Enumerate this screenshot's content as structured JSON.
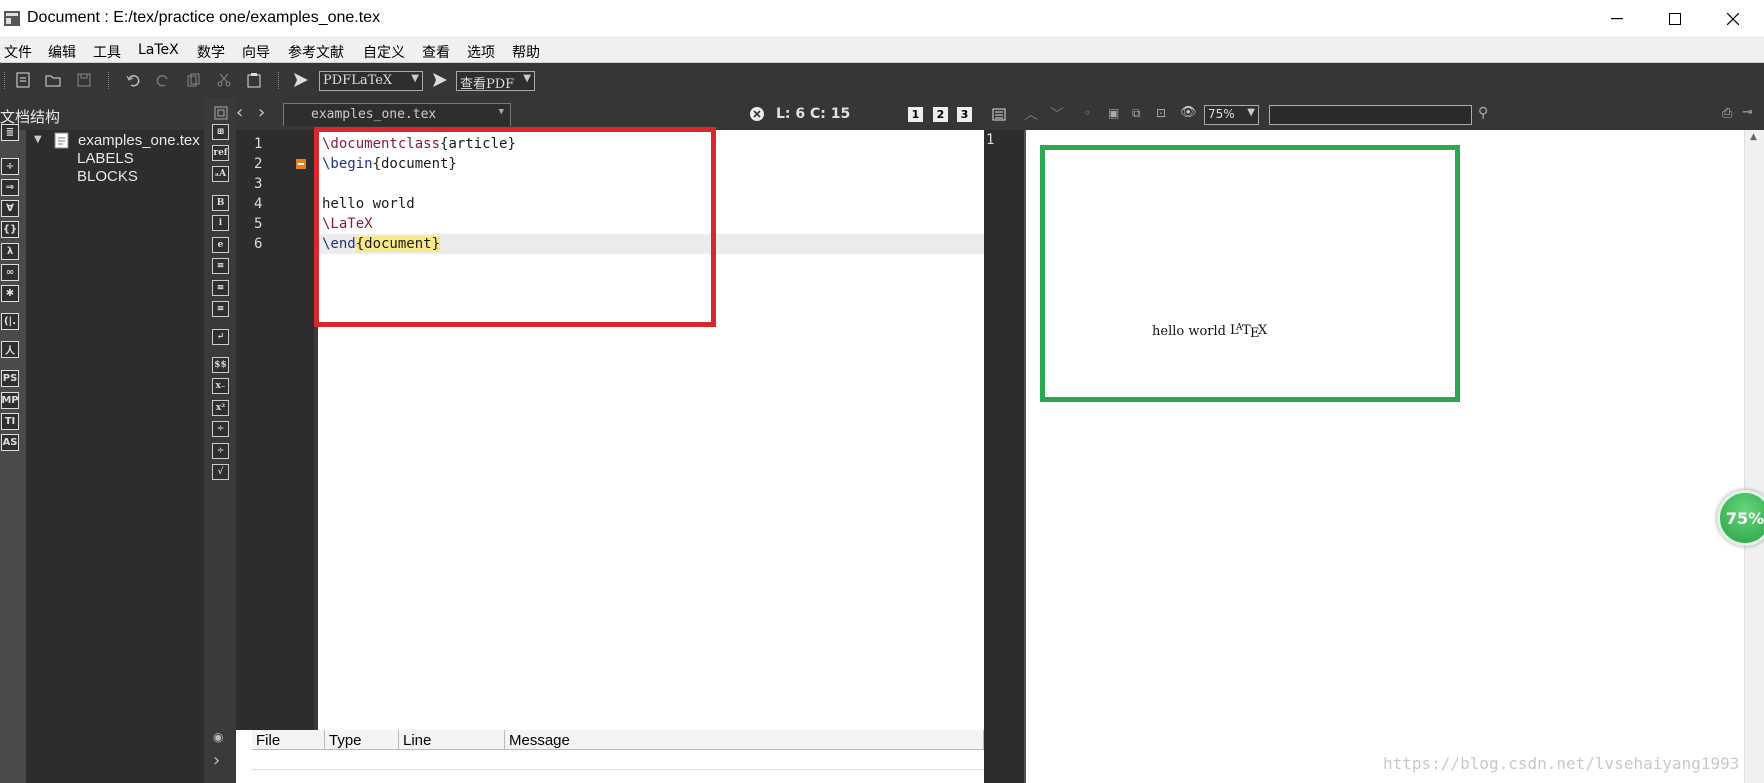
{
  "window": {
    "title": "Document : E:/tex/practice one/examples_one.tex",
    "minimize": "—",
    "maximize": "☐",
    "close": "✕"
  },
  "menu": [
    "文件",
    "编辑",
    "工具",
    "LaTeX",
    "数学",
    "向导",
    "参考文献",
    "自定义",
    "查看",
    "选项",
    "帮助"
  ],
  "toolbar": {
    "compiler": "PDFLaTeX",
    "viewer": "查看PDF"
  },
  "structure": {
    "header": "文档结构",
    "file": "examples_one.tex",
    "items": [
      "LABELS",
      "BLOCKS"
    ]
  },
  "left_icons": [
    "≣",
    "÷",
    "⇒",
    "∀",
    "{}",
    "λ",
    "∞",
    "✱",
    "(|.",
    "⼈",
    "PS",
    "MP",
    "TI",
    "AS"
  ],
  "mid_icons": [
    "⊞",
    "ref",
    "ₐA",
    "B",
    "i",
    "e",
    "≡",
    "≡",
    "≡",
    "↵",
    "$$",
    "x₋",
    "x²",
    "÷",
    "÷",
    "√"
  ],
  "editor": {
    "tab": "examples_one.tex",
    "position": "L: 6 C: 15",
    "view_numbers": [
      "1",
      "2",
      "3"
    ],
    "lines": [
      {
        "num": "1",
        "cmd": "\\documentclass",
        "rest": "{article}"
      },
      {
        "num": "2",
        "cmd": "\\begin",
        "rest": "{document}"
      },
      {
        "num": "3",
        "cmd": "",
        "rest": ""
      },
      {
        "num": "4",
        "cmd": "",
        "rest": "hello world"
      },
      {
        "num": "5",
        "cmd": "\\LaTeX",
        "rest": ""
      },
      {
        "num": "6",
        "cmd": "\\end",
        "rest": "{document}"
      }
    ]
  },
  "messages": {
    "columns": [
      "File",
      "Type",
      "Line",
      "Message"
    ]
  },
  "pdf": {
    "zoom": "75%",
    "page": "1",
    "text_plain": "hello world ",
    "latex_logo": "LATEX",
    "badge": "75%"
  },
  "watermark": "https://blog.csdn.net/lvsehaiyang1993"
}
